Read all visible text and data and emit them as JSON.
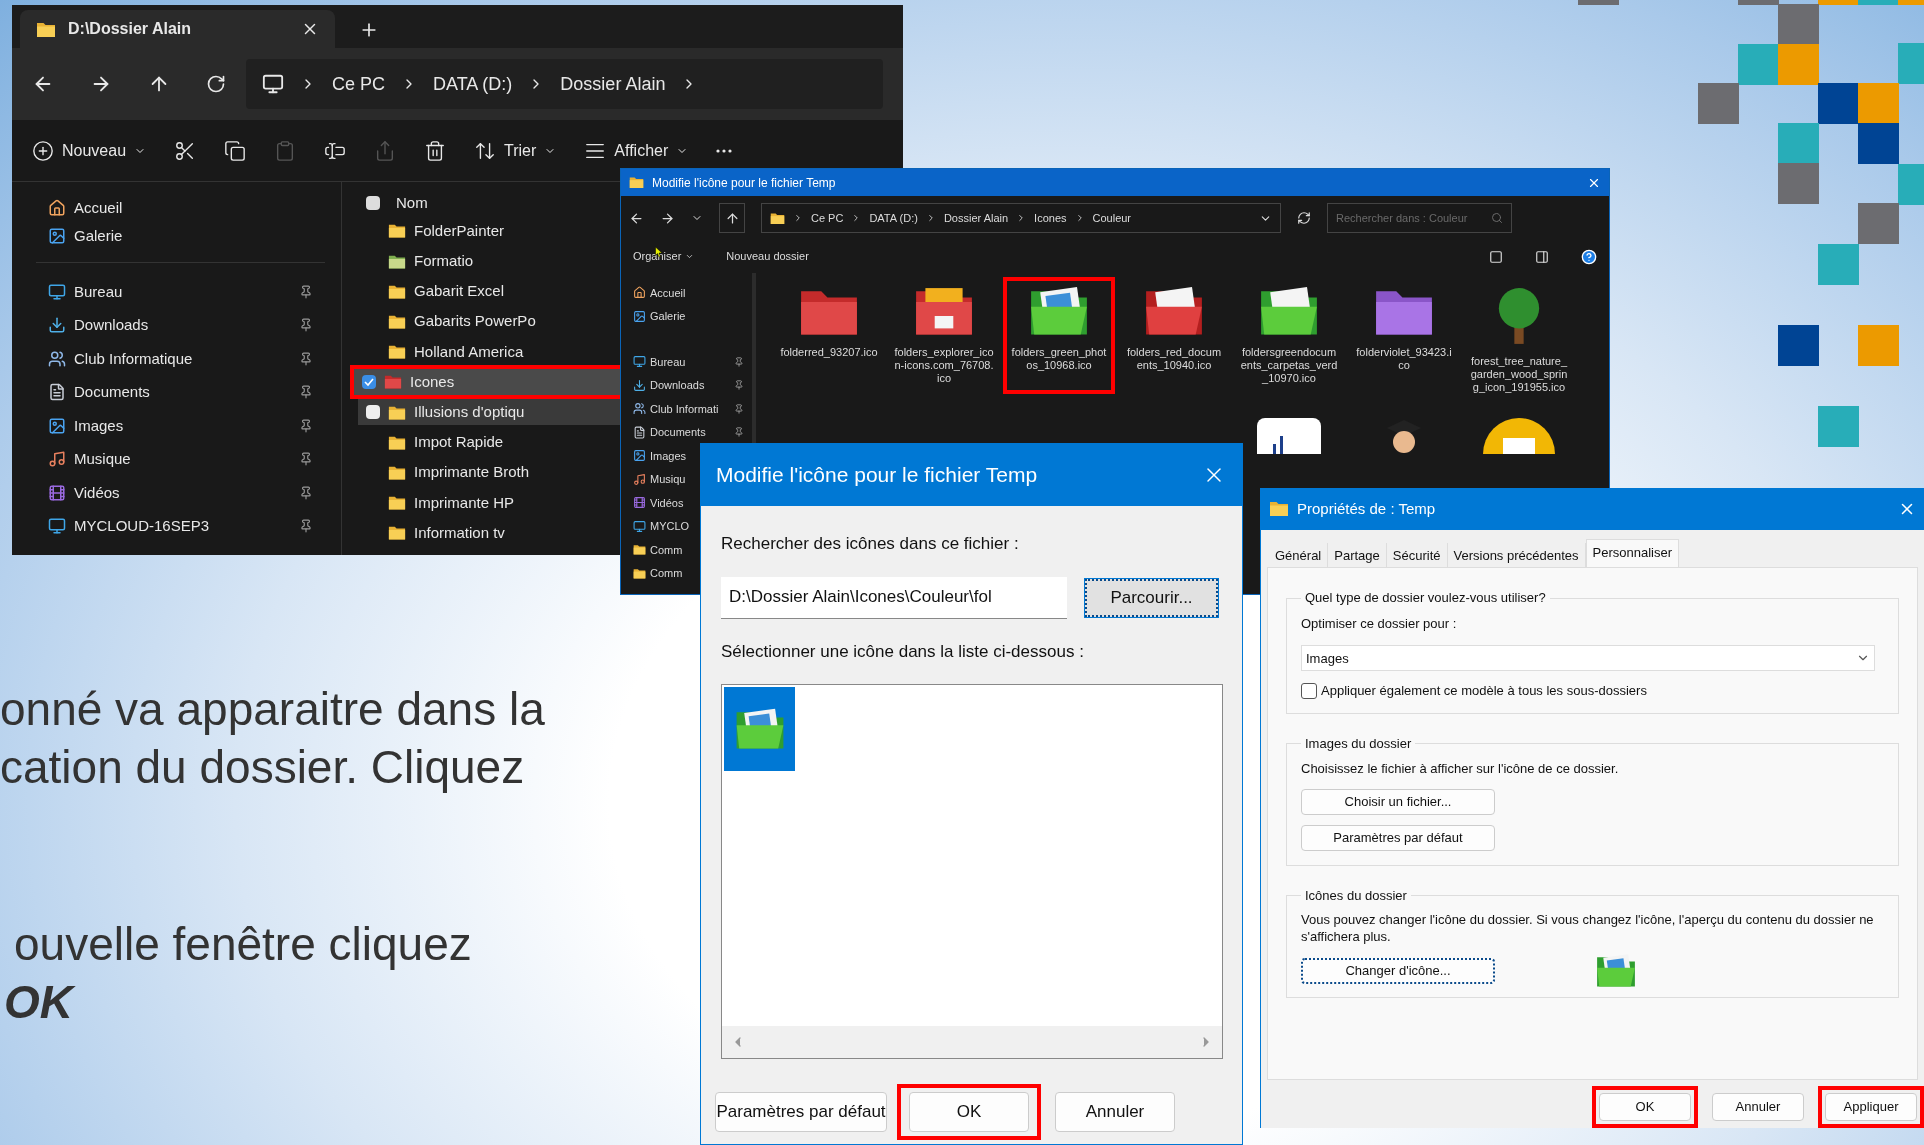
{
  "slide_text": {
    "paragraph_1": [
      "onné va apparaitre dans la",
      "cation du dossier. Cliquez"
    ],
    "paragraph_2": [
      "ouvelle fenêtre cliquez"
    ],
    "emphasis": "OK"
  },
  "explorer": {
    "tab_title": "D:\\Dossier Alain",
    "breadcrumb": [
      "Ce PC",
      "DATA (D:)",
      "Dossier Alain"
    ],
    "toolbar": [
      {
        "kind": "new",
        "label": "Nouveau",
        "disabled": false
      },
      {
        "kind": "cut",
        "disabled": false
      },
      {
        "kind": "copy",
        "disabled": false
      },
      {
        "kind": "paste",
        "disabled": true
      },
      {
        "kind": "rename",
        "disabled": false
      },
      {
        "kind": "share",
        "disabled": true
      },
      {
        "kind": "delete",
        "disabled": false
      },
      {
        "kind": "sort",
        "label": "Trier",
        "disabled": false
      },
      {
        "kind": "view",
        "label": "Afficher",
        "disabled": false
      },
      {
        "kind": "more",
        "disabled": false
      }
    ],
    "quick_access": [
      {
        "label": "Accueil",
        "kind": "home"
      },
      {
        "label": "Galerie",
        "kind": "gallery"
      }
    ],
    "pinned": [
      {
        "label": "Bureau",
        "kind": "desktop"
      },
      {
        "label": "Downloads",
        "kind": "download"
      },
      {
        "label": "Club Informatique",
        "kind": "network"
      },
      {
        "label": "Documents",
        "kind": "document"
      },
      {
        "label": "Images",
        "kind": "gallery"
      },
      {
        "label": "Musique",
        "kind": "music"
      },
      {
        "label": "Vidéos",
        "kind": "video"
      },
      {
        "label": "MYCLOUD-16SEP3",
        "kind": "desktop"
      }
    ],
    "column_header": "Nom",
    "select_all_checked": false,
    "rows": [
      {
        "name": "FolderPainter",
        "kind": "folder",
        "selected": false,
        "checked": false,
        "hovered": false,
        "highlighted": false
      },
      {
        "name": "Formatio",
        "kind": "picture_folder",
        "selected": false,
        "checked": false,
        "hovered": false,
        "highlighted": false
      },
      {
        "name": "Gabarit Excel",
        "kind": "folder",
        "selected": false,
        "checked": false,
        "hovered": false,
        "highlighted": false
      },
      {
        "name": "Gabarits PowerPo",
        "kind": "folder",
        "selected": false,
        "checked": false,
        "hovered": false,
        "highlighted": false
      },
      {
        "name": "Holland America",
        "kind": "folder",
        "selected": false,
        "checked": false,
        "hovered": false,
        "highlighted": false
      },
      {
        "name": "Icones",
        "kind": "red_folder",
        "selected": true,
        "checked": true,
        "hovered": false,
        "highlighted": true
      },
      {
        "name": "Illusions d'optiqu",
        "kind": "folder",
        "selected": false,
        "checked": false,
        "hovered": true,
        "highlighted": false
      },
      {
        "name": "Impot Rapide",
        "kind": "folder",
        "selected": false,
        "checked": false,
        "hovered": false,
        "highlighted": false
      },
      {
        "name": "Imprimante Broth",
        "kind": "folder",
        "selected": false,
        "checked": false,
        "hovered": false,
        "highlighted": false
      },
      {
        "name": "Imprimante HP",
        "kind": "folder",
        "selected": false,
        "checked": false,
        "hovered": false,
        "highlighted": false
      },
      {
        "name": "Information tv",
        "kind": "folder",
        "selected": false,
        "checked": false,
        "hovered": false,
        "highlighted": false
      }
    ]
  },
  "file_dialog": {
    "title": "Modifie l'icône pour le fichier Temp",
    "breadcrumb": [
      "Ce PC",
      "DATA (D:)",
      "Dossier Alain",
      "Icones",
      "Couleur"
    ],
    "search": {
      "placeholder": "Rechercher dans : Couleur"
    },
    "toolbar": [
      "Organiser",
      "Nouveau dossier"
    ],
    "nav": [
      {
        "label": "Accueil",
        "kind": "home",
        "pinned": false
      },
      {
        "label": "Galerie",
        "kind": "gallery",
        "pinned": false
      },
      {
        "label": "Bureau",
        "kind": "desktop",
        "pinned": true
      },
      {
        "label": "Downloads",
        "kind": "download",
        "pinned": true
      },
      {
        "label": "Club Informati",
        "kind": "network",
        "pinned": true
      },
      {
        "label": "Documents",
        "kind": "document",
        "pinned": true
      },
      {
        "label": "Images",
        "kind": "gallery"
      },
      {
        "label": "Musiqu",
        "kind": "music"
      },
      {
        "label": "Vidéos",
        "kind": "video"
      },
      {
        "label": "MYCLO",
        "kind": "desktop"
      },
      {
        "label": "Comm",
        "kind": "folder"
      },
      {
        "label": "Comm",
        "kind": "folder"
      }
    ],
    "files": [
      {
        "name": "folderred_93207.ico",
        "kind": "red_folder",
        "highlighted": false
      },
      {
        "name": "folders_explorer_icon-icons.com_76708.ico",
        "kind": "red_box_folder",
        "highlighted": false
      },
      {
        "name": "folders_green_photos_10968.ico",
        "kind": "green_photo_folder",
        "highlighted": true
      },
      {
        "name": "folders_red_documents_10940.ico",
        "kind": "red_doc_folder",
        "highlighted": false
      },
      {
        "name": "foldersgreendocuments_carpetas_verd_10970.ico",
        "kind": "green_doc_folder",
        "highlighted": false
      },
      {
        "name": "folderviolet_93423.ico",
        "kind": "violet_folder",
        "highlighted": false
      },
      {
        "name": "forest_tree_nature_garden_wood_spring_icon_191955.ico",
        "kind": "tree",
        "highlighted": false
      }
    ],
    "partial_row": [
      {
        "kind": "chart"
      },
      {
        "kind": "person"
      },
      {
        "kind": "mail"
      }
    ]
  },
  "icon_dialog": {
    "title": "Modifie l'icône pour le fichier Temp",
    "search_label": "Rechercher des icônes dans ce fichier :",
    "path_value": "D:\\Dossier Alain\\Icones\\Couleur\\fol",
    "browse_button": "Parcourir...",
    "list_label": "Sélectionner une icône dans la liste ci-dessous :",
    "icons": [
      {
        "kind": "green_photo_folder",
        "selected": true
      }
    ],
    "buttons": [
      {
        "label": "Paramètres par défaut",
        "highlighted": false
      },
      {
        "label": "OK",
        "highlighted": true
      },
      {
        "label": "Annuler",
        "highlighted": false
      }
    ]
  },
  "properties": {
    "title": "Propriétés de : Temp",
    "tabs": [
      {
        "label": "Général",
        "selected": false
      },
      {
        "label": "Partage",
        "selected": false
      },
      {
        "label": "Sécurité",
        "selected": false
      },
      {
        "label": "Versions précédentes",
        "selected": false
      },
      {
        "label": "Personnaliser",
        "selected": true
      }
    ],
    "folder_type": {
      "legend": "Quel type de dossier voulez-vous utiliser?",
      "optimize_label": "Optimiser ce dossier pour :",
      "dropdown_value": "Images",
      "apply_all": {
        "label": "Appliquer également ce modèle à tous les sous-dossiers",
        "checked": false
      }
    },
    "folder_pictures": {
      "legend": "Images du dossier",
      "description": "Choisissez le fichier à afficher sur l'icône de ce dossier.",
      "buttons": [
        "Choisir un fichier...",
        "Paramètres par défaut"
      ]
    },
    "folder_icons": {
      "legend": "Icônes du dossier",
      "description": "Vous pouvez changer l'icône du dossier. Si vous changez l'icône, l'aperçu du contenu du dossier ne s'affichera plus.",
      "button": "Changer d'icône...",
      "preview_icon": {
        "kind": "green_photo_folder"
      }
    },
    "buttons": [
      {
        "label": "OK",
        "highlighted": true
      },
      {
        "label": "Annuler",
        "highlighted": false
      },
      {
        "label": "Appliquer",
        "highlighted": true
      }
    ]
  }
}
